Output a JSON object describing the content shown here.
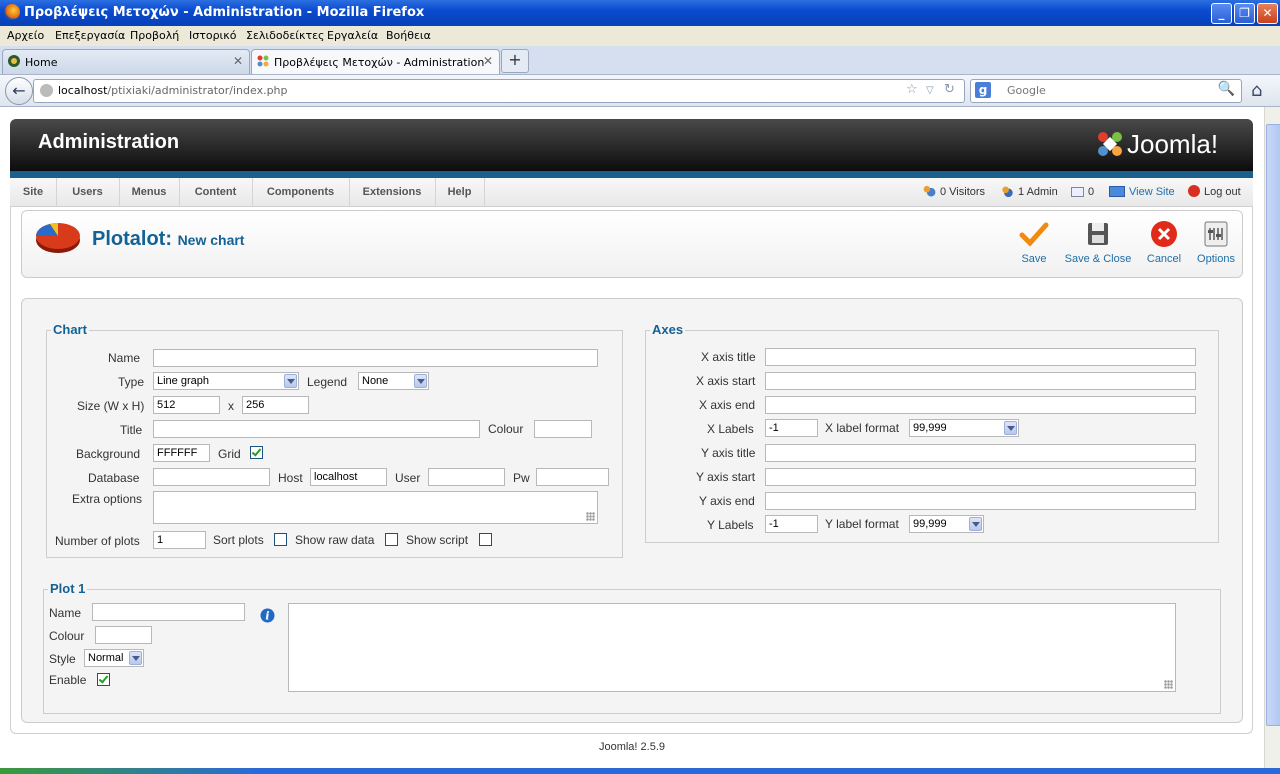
{
  "window": {
    "title": "Προβλέψεις Μετοχών - Administration - Mozilla Firefox"
  },
  "menubar": [
    "Αρχείο",
    "Επεξεργασία",
    "Προβολή",
    "Ιστορικό",
    "Σελιδοδείκτες",
    "Εργαλεία",
    "Βοήθεια"
  ],
  "tabs": [
    {
      "label": "Home"
    },
    {
      "label": "Προβλέψεις Μετοχών - Administration"
    }
  ],
  "nav": {
    "url_host": "localhost",
    "url_path": "/ptixiaki/administrator/index.php",
    "search_placeholder": "Google"
  },
  "header": {
    "title": "Administration",
    "brand": "Joomla!"
  },
  "admin_menu": [
    "Site",
    "Users",
    "Menus",
    "Content",
    "Components",
    "Extensions",
    "Help"
  ],
  "status": {
    "visitors": "0 Visitors",
    "admins": "1 Admin",
    "messages": "0",
    "view_site": "View Site",
    "logout": "Log out"
  },
  "toolbar": {
    "component": "Plotalot:",
    "subtitle": "New chart",
    "save": "Save",
    "save_close": "Save & Close",
    "cancel": "Cancel",
    "options": "Options"
  },
  "chart": {
    "legend": "Chart",
    "name_label": "Name",
    "name_value": "",
    "type_label": "Type",
    "type_value": "Line graph",
    "legend_label": "Legend",
    "legend_value": "None",
    "size_label": "Size (W x H)",
    "width": "512",
    "x": "x",
    "height": "256",
    "title_label": "Title",
    "colour_label": "Colour",
    "background_label": "Background",
    "background_value": "FFFFFF",
    "grid_label": "Grid",
    "grid_checked": true,
    "database_label": "Database",
    "host_label": "Host",
    "host_value": "localhost",
    "user_label": "User",
    "pw_label": "Pw",
    "extra_label": "Extra options",
    "num_plots_label": "Number of plots",
    "num_plots_value": "1",
    "sort_label": "Sort plots",
    "raw_label": "Show raw data",
    "script_label": "Show script"
  },
  "axes": {
    "legend": "Axes",
    "x_title": "X axis title",
    "x_start": "X axis start",
    "x_end": "X axis end",
    "x_labels": "X Labels",
    "x_labels_value": "-1",
    "x_format_label": "X label format",
    "x_format_value": "99,999",
    "y_title": "Y axis title",
    "y_start": "Y axis start",
    "y_end": "Y axis end",
    "y_labels": "Y Labels",
    "y_labels_value": "-1",
    "y_format_label": "Y label format",
    "y_format_value": "99,999"
  },
  "plot1": {
    "legend": "Plot 1",
    "name_label": "Name",
    "colour_label": "Colour",
    "style_label": "Style",
    "style_value": "Normal",
    "enable_label": "Enable",
    "enabled": true
  },
  "footer": "Joomla! 2.5.9"
}
